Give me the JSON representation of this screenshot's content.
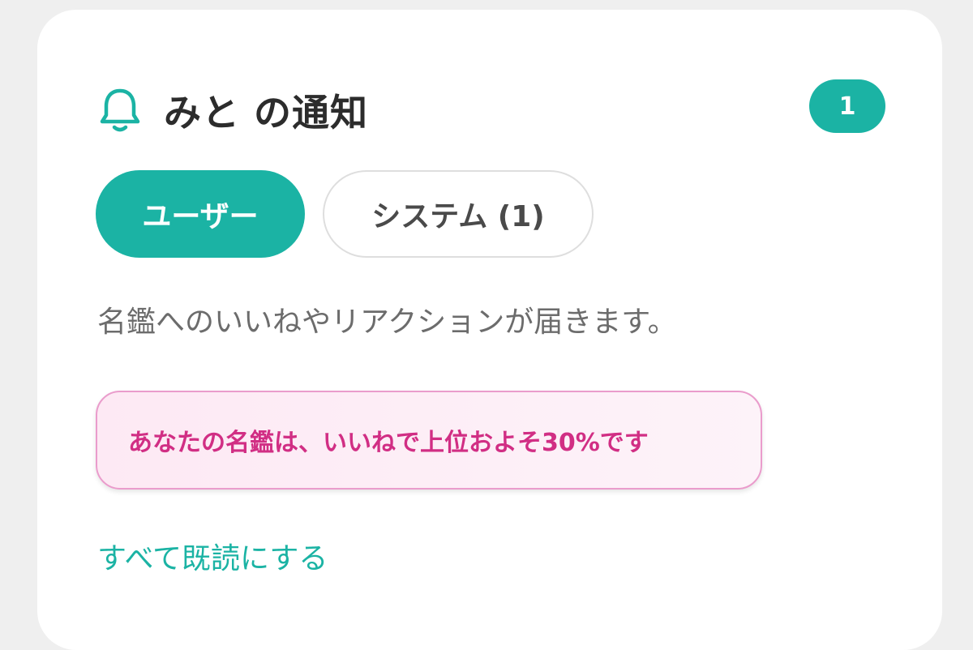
{
  "header": {
    "title": "みと の通知",
    "icon": "bell-icon",
    "unread_count": "1"
  },
  "tabs": [
    {
      "label": "ユーザー",
      "active": true
    },
    {
      "label": "システム (1)",
      "active": false
    }
  ],
  "description": "名鑑へのいいねやリアクションが届きます。",
  "notice": {
    "text": "あなたの名鑑は、いいねで上位およそ30%です"
  },
  "actions": {
    "mark_all_read": "すべて既読にする"
  },
  "colors": {
    "accent": "#1bb3a4",
    "notice_text": "#d12e84",
    "notice_border": "#ea9ccc",
    "notice_bg": "#fde9f4"
  }
}
